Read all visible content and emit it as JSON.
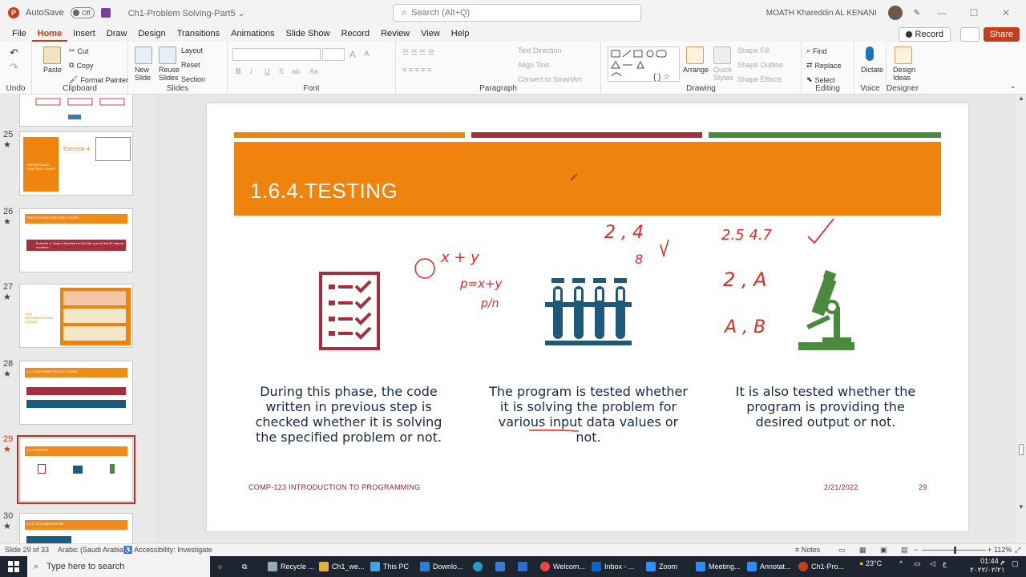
{
  "window": {
    "autosave_label": "AutoSave",
    "autosave_state": "Off",
    "filename": "Ch1-Problem Solving-Part5",
    "filename_arrow": "⌄",
    "search_placeholder": "Search (Alt+Q)",
    "user_name": "MOATH Khareddin  AL KENANI"
  },
  "menu": [
    "File",
    "Home",
    "Insert",
    "Draw",
    "Design",
    "Transitions",
    "Animations",
    "Slide Show",
    "Record",
    "Review",
    "View",
    "Help"
  ],
  "menu_active": "Home",
  "record_label": "Record",
  "share_label": "Share",
  "ribbon": {
    "undo_label": "Undo",
    "clipboard": {
      "paste": "Paste",
      "cut": "Cut",
      "copy": "Copy",
      "format_painter": "Format Painter",
      "label": "Clipboard"
    },
    "slides": {
      "new_slide": "New",
      "new_slide2": "Slide",
      "reuse": "Reuse",
      "reuse2": "Slides",
      "layout": "Layout",
      "reset": "Reset",
      "section": "Section",
      "label": "Slides"
    },
    "font": {
      "label": "Font",
      "bold": "B",
      "italic": "I",
      "underline": "U",
      "strike": "S",
      "spacing": "ab",
      "case": "Aa",
      "grow": "A",
      "shrink": "A"
    },
    "paragraph": {
      "label": "Paragraph",
      "text_direction": "Text Direction",
      "align_text": "Align Text",
      "convert": "Convert to SmartArt"
    },
    "drawing": {
      "label": "Drawing",
      "arrange": "Arrange",
      "quick_styles": "Quick",
      "quick_styles2": "Styles",
      "shape_fill": "Shape Fill",
      "shape_outline": "Shape Outline",
      "shape_effects": "Shape Effects"
    },
    "editing": {
      "label": "Editing",
      "find": "Find",
      "replace": "Replace",
      "select": "Select"
    },
    "voice": {
      "label": "Voice",
      "dictate": "Dictate"
    },
    "designer": {
      "label": "Designer",
      "design_ideas": "Design",
      "design_ideas2": "Ideas"
    }
  },
  "thumbnails": [
    {
      "num": "25",
      "star": "★",
      "title": "Exercise 4",
      "side": "PRETEST AND POSTTEST LOOPS"
    },
    {
      "num": "26",
      "star": "★",
      "title": "PRETEST AND POSTTEST LOOPS",
      "body": "Exercise 4: Draw a flowchart to find the sum of first 50 natural numbers."
    },
    {
      "num": "27",
      "star": "★",
      "title": "1.6.3. IMPLEMENTATION: CODING"
    },
    {
      "num": "28",
      "star": "★",
      "title": "1.6.3. IMPLEMENTATION: CODING"
    },
    {
      "num": "29",
      "star": "★",
      "title": "1.6.4.TESTING"
    },
    {
      "num": "30",
      "star": "★",
      "title": "1.6.5. DOCUMENTATION"
    }
  ],
  "slide": {
    "title": "1.6.4.TESTING",
    "columns": [
      "During this phase, the code written in previous step is checked whether it is solving the specified problem or not.",
      "The program is tested whether it is solving the problem for various input data values or not.",
      "It is also tested whether the program is providing the desired output or not."
    ],
    "footer_left": "COMP-123 INTRODUCTION TO PROGRAMMING",
    "footer_date": "2/21/2022",
    "footer_page": "29",
    "ink": [
      "x + y",
      "p=x+y",
      "p/n",
      "2 , 4",
      "8",
      "2.5  4.7",
      "2  , A",
      "A , B"
    ],
    "colors": {
      "orange": "#ee840e",
      "maroon": "#a3303c",
      "green": "#4a8a3e",
      "blue": "#1f5a7a",
      "red_ink": "#e02b2b"
    }
  },
  "status": {
    "slide_of": "Slide 29 of 33",
    "language": "Arabic (Saudi Arabia)",
    "accessibility": "Accessibility: Investigate",
    "notes": "Notes",
    "zoom": "112%"
  },
  "taskbar": {
    "search": "Type here to search",
    "apps": [
      "Recycle ...",
      "Ch1_we...",
      "This PC",
      "Downlo...",
      "Welcom...",
      "Inbox - ...",
      "Zoom",
      "Meeting...",
      "Annotat...",
      "Ch1-Pro..."
    ],
    "temp": "23°C",
    "time": "01:44 م",
    "date": "٢٠٢٢/٠٢/٢١"
  }
}
